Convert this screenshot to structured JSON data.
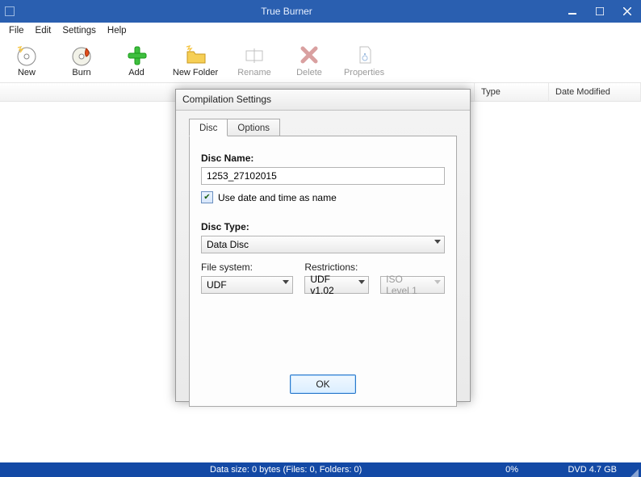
{
  "title": "True Burner",
  "menu": {
    "file": "File",
    "edit": "Edit",
    "settings": "Settings",
    "help": "Help"
  },
  "toolbar": {
    "new": "New",
    "burn": "Burn",
    "add": "Add",
    "newFolder": "New Folder",
    "rename": "Rename",
    "delete": "Delete",
    "properties": "Properties"
  },
  "columns": {
    "type": "Type",
    "date": "Date Modified"
  },
  "status": {
    "datasize": "Data size: 0 bytes (Files: 0, Folders: 0)",
    "pct": "0%",
    "media": "DVD 4.7 GB"
  },
  "dialog": {
    "title": "Compilation Settings",
    "tabs": {
      "disc": "Disc",
      "options": "Options"
    },
    "discNameLabel": "Disc Name:",
    "discNameValue": "1253_27102015",
    "useDateChecked": true,
    "useDateLabel": "Use date and time as name",
    "discTypeLabel": "Disc Type:",
    "discTypeValue": "Data Disc",
    "fsLabel": "File system:",
    "fsValue": "UDF",
    "restrLabel": "Restrictions:",
    "restrValue": "UDF v1.02",
    "isoValue": "ISO Level 1",
    "ok": "OK"
  }
}
